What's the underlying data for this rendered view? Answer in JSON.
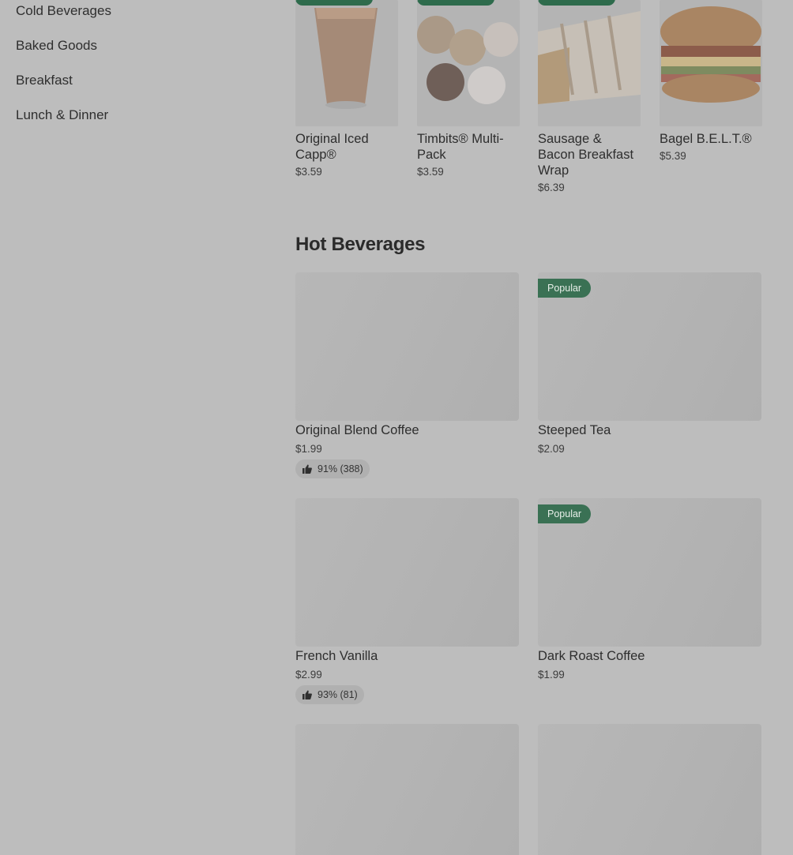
{
  "sidebar": {
    "items": [
      {
        "label": "Cold Beverages"
      },
      {
        "label": "Baked Goods"
      },
      {
        "label": "Breakfast"
      },
      {
        "label": "Lunch & Dinner"
      }
    ]
  },
  "featured": [
    {
      "name": "Original Iced Capp®",
      "price": "$3.59"
    },
    {
      "name": "Timbits® Multi-Pack",
      "price": "$3.59"
    },
    {
      "name": "Sausage & Bacon Breakfast Wrap",
      "price": "$6.39"
    },
    {
      "name": "Bagel B.E.L.T.®",
      "price": "$5.39"
    }
  ],
  "hot_beverages": {
    "title": "Hot Beverages",
    "items": [
      {
        "name": "Original Blend Coffee",
        "price": "$1.99",
        "badge": "",
        "rating": "91% (388)"
      },
      {
        "name": "Steeped Tea",
        "price": "$2.09",
        "badge": "Popular",
        "rating": ""
      },
      {
        "name": "French Vanilla",
        "price": "$2.99",
        "badge": "",
        "rating": "93% (81)"
      },
      {
        "name": "Dark Roast Coffee",
        "price": "$1.99",
        "badge": "Popular",
        "rating": ""
      },
      {
        "name": "",
        "price": "",
        "badge": "",
        "rating": ""
      },
      {
        "name": "",
        "price": "",
        "badge": "",
        "rating": ""
      }
    ]
  },
  "colors": {
    "badge_green": "#3a7154",
    "overlay_gray": "#bdbdbd"
  },
  "icons": {
    "rating": "thumbs-up-icon"
  }
}
